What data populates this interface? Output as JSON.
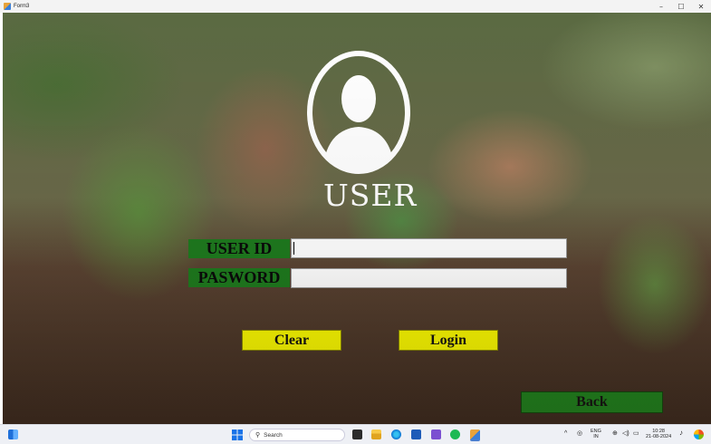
{
  "window": {
    "title": "Form3",
    "controls": [
      "–",
      "☐",
      "✕"
    ]
  },
  "form": {
    "heading": "USER",
    "userid_label": "USER ID",
    "password_label": "PASWORD",
    "userid_value": "",
    "password_value": "",
    "clear_label": "Clear",
    "login_label": "Login",
    "back_label": "Back"
  },
  "colors": {
    "label_bg": "#1e7a1e",
    "button_yellow": "#ffff00",
    "back_green": "#1f8a1f"
  },
  "taskbar": {
    "search_placeholder": "Search",
    "lang_line1": "ENG",
    "lang_line2": "IN",
    "time": "10:28",
    "date": "21-08-2024",
    "icons": [
      "windows-start-icon",
      "search-icon",
      "task-view-icon",
      "file-explorer-icon",
      "edge-icon",
      "store-icon",
      "visual-studio-icon",
      "spotify-icon",
      "form-app-icon"
    ]
  }
}
